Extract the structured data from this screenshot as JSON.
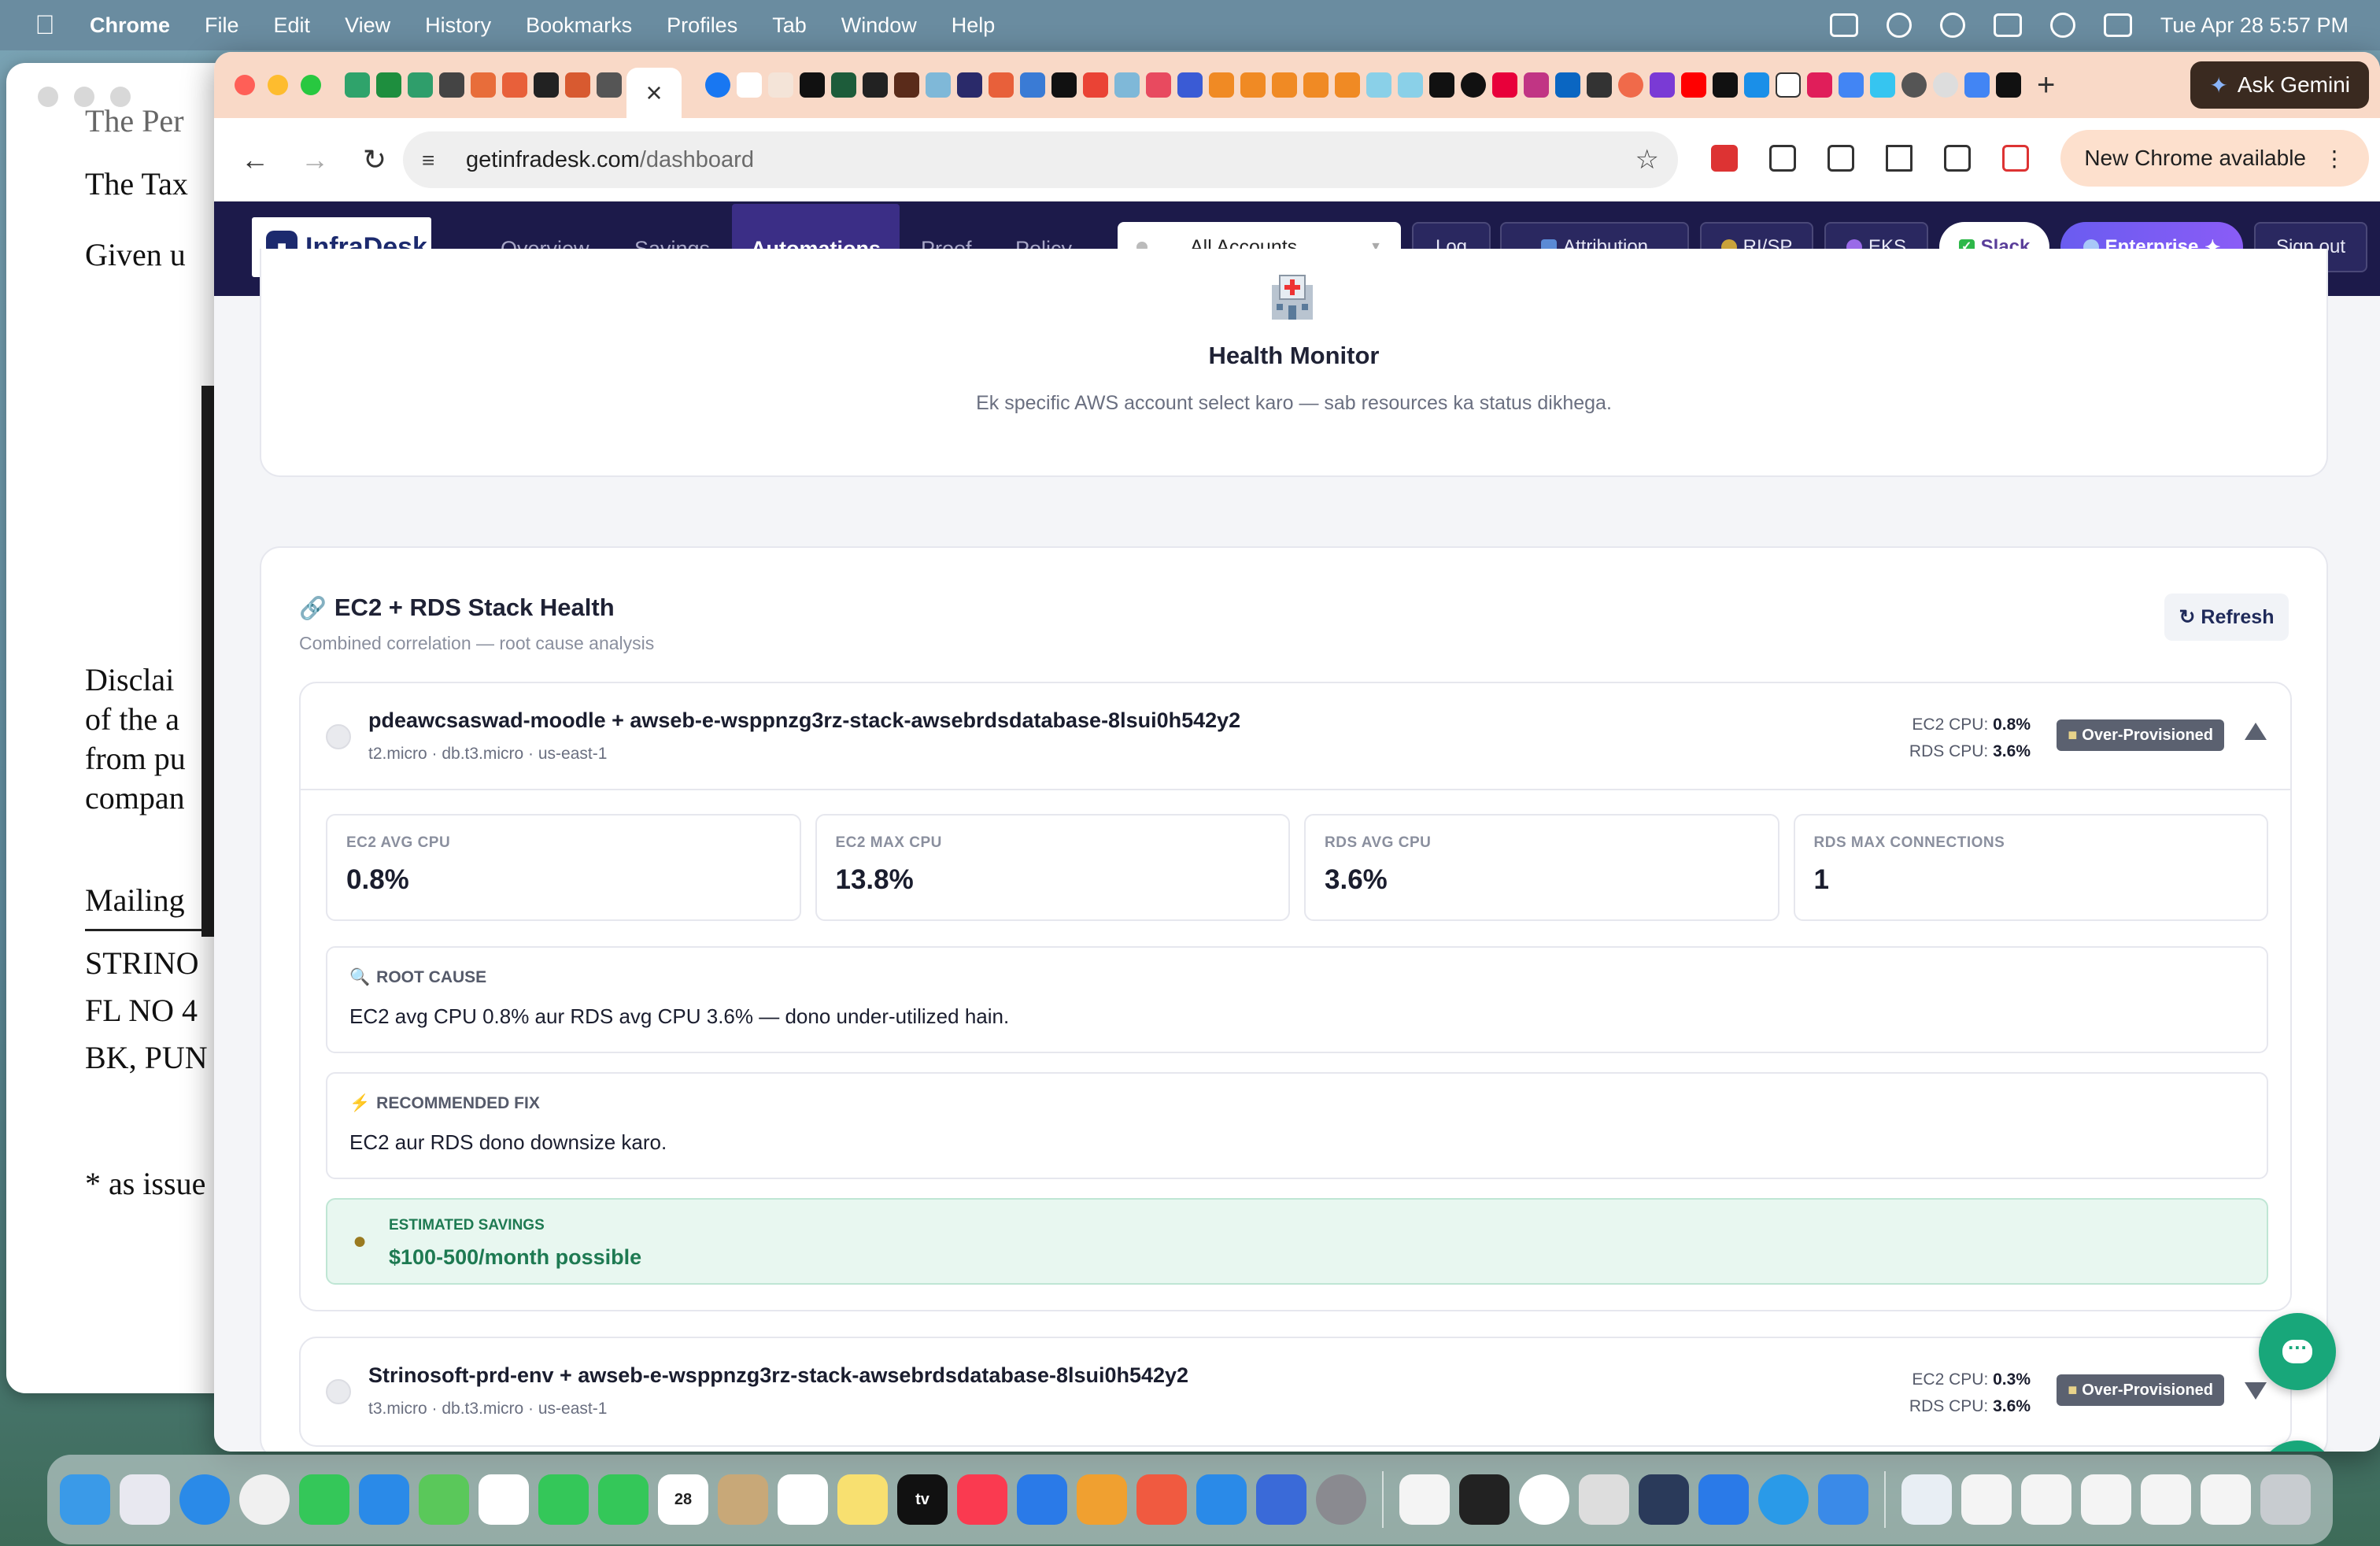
{
  "menubar": {
    "app": "Chrome",
    "items": [
      "File",
      "Edit",
      "View",
      "History",
      "Bookmarks",
      "Profiles",
      "Tab",
      "Window",
      "Help"
    ],
    "datetime": "Tue Apr 28  5:57 PM"
  },
  "background_doc": {
    "lines": [
      "The Per",
      "The Tax",
      "Given u",
      "Disclai",
      "of the a",
      "from pu",
      "compan",
      "Mailing",
      "STRINO",
      "FL NO 4",
      "BK, PUN",
      "* as issue"
    ]
  },
  "browser": {
    "ask_gemini": "Ask Gemini",
    "url_host": "getinfradesk.com",
    "url_path": "/dashboard",
    "update_label": "New Chrome available",
    "tab_close": "×",
    "new_tab": "+"
  },
  "app": {
    "logo": "InfraDesk",
    "nav": [
      "Overview",
      "Savings",
      "Automations",
      "Proof",
      "Policy"
    ],
    "active_nav": "Automations",
    "account_select": "All Accounts",
    "buttons": {
      "log": "Log",
      "attribution": "Attribution",
      "ri_sp": "RI/SP",
      "eks": "EKS",
      "slack": "Slack",
      "enterprise": "Enterprise",
      "signout": "Sign out"
    }
  },
  "health_monitor": {
    "title": "Health Monitor",
    "subtitle": "Ek specific AWS account select karo — sab resources ka status dikhega."
  },
  "stack_health": {
    "title": "EC2 + RDS Stack Health",
    "subtitle": "Combined correlation — root cause analysis",
    "refresh": "↻ Refresh",
    "items": [
      {
        "name": "pdeawcsaswad-moodle + awseb-e-wsppnzg3rz-stack-awsebrdsdatabase-8lsui0h542y2",
        "meta": "t2.micro · db.t3.micro · us-east-1",
        "ec2_cpu_label": "EC2 CPU:",
        "ec2_cpu": "0.8%",
        "rds_cpu_label": "RDS CPU:",
        "rds_cpu": "3.6%",
        "badge": "Over-Provisioned",
        "metrics": [
          {
            "label": "EC2 AVG CPU",
            "value": "0.8%"
          },
          {
            "label": "EC2 MAX CPU",
            "value": "13.8%"
          },
          {
            "label": "RDS AVG CPU",
            "value": "3.6%"
          },
          {
            "label": "RDS MAX CONNECTIONS",
            "value": "1"
          }
        ],
        "root_cause_label": "ROOT CAUSE",
        "root_cause": "EC2 avg CPU 0.8% aur RDS avg CPU 3.6% — dono under-utilized hain.",
        "fix_label": "RECOMMENDED FIX",
        "fix": "EC2 aur RDS dono downsize karo.",
        "savings_label": "ESTIMATED SAVINGS",
        "savings": "$100-500/month possible"
      },
      {
        "name": "Strinosoft-prd-env + awseb-e-wsppnzg3rz-stack-awsebrdsdatabase-8lsui0h542y2",
        "meta": "t3.micro · db.t3.micro · us-east-1",
        "ec2_cpu_label": "EC2 CPU:",
        "ec2_cpu": "0.3%",
        "rds_cpu_label": "RDS CPU:",
        "rds_cpu": "3.6%",
        "badge": "Over-Provisioned"
      }
    ]
  },
  "fab": {
    "help": "?"
  },
  "colors": {
    "nav_bg": "#1c1a4a",
    "accent": "#3b2e86",
    "badge": "#5b6170",
    "savings_green": "#1e7a52",
    "fab": "#18a77a"
  }
}
